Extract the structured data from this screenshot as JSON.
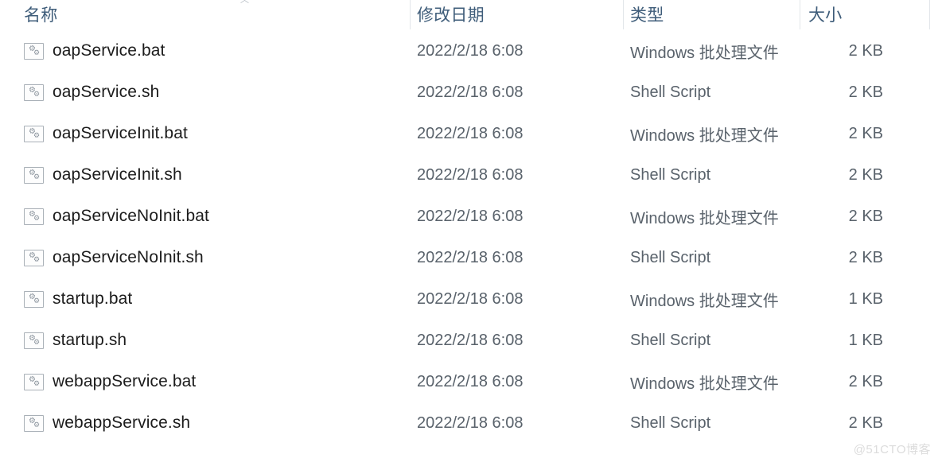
{
  "columns": [
    {
      "key": "name",
      "label": "名称",
      "icon": "sort-indicator"
    },
    {
      "key": "date",
      "label": "修改日期"
    },
    {
      "key": "type",
      "label": "类型"
    },
    {
      "key": "size",
      "label": "大小"
    }
  ],
  "sort_glyph": "︿",
  "rows": [
    {
      "icon": "script-file-icon",
      "name": "oapService.bat",
      "date": "2022/2/18 6:08",
      "type": "Windows 批处理文件",
      "size": "2 KB"
    },
    {
      "icon": "script-file-icon",
      "name": "oapService.sh",
      "date": "2022/2/18 6:08",
      "type": "Shell Script",
      "size": "2 KB"
    },
    {
      "icon": "script-file-icon",
      "name": "oapServiceInit.bat",
      "date": "2022/2/18 6:08",
      "type": "Windows 批处理文件",
      "size": "2 KB"
    },
    {
      "icon": "script-file-icon",
      "name": "oapServiceInit.sh",
      "date": "2022/2/18 6:08",
      "type": "Shell Script",
      "size": "2 KB"
    },
    {
      "icon": "script-file-icon",
      "name": "oapServiceNoInit.bat",
      "date": "2022/2/18 6:08",
      "type": "Windows 批处理文件",
      "size": "2 KB"
    },
    {
      "icon": "script-file-icon",
      "name": "oapServiceNoInit.sh",
      "date": "2022/2/18 6:08",
      "type": "Shell Script",
      "size": "2 KB"
    },
    {
      "icon": "script-file-icon",
      "name": "startup.bat",
      "date": "2022/2/18 6:08",
      "type": "Windows 批处理文件",
      "size": "1 KB"
    },
    {
      "icon": "script-file-icon",
      "name": "startup.sh",
      "date": "2022/2/18 6:08",
      "type": "Shell Script",
      "size": "1 KB"
    },
    {
      "icon": "script-file-icon",
      "name": "webappService.bat",
      "date": "2022/2/18 6:08",
      "type": "Windows 批处理文件",
      "size": "2 KB"
    },
    {
      "icon": "script-file-icon",
      "name": "webappService.sh",
      "date": "2022/2/18 6:08",
      "type": "Shell Script",
      "size": "2 KB"
    }
  ],
  "watermark": "@51CTO博客",
  "colors": {
    "header_text": "#3f5d7a",
    "name_text": "#1c1c1c",
    "meta_text": "#59626b",
    "separator": "#e2e6ea",
    "watermark": "#dcdcdc",
    "background": "#ffffff"
  }
}
